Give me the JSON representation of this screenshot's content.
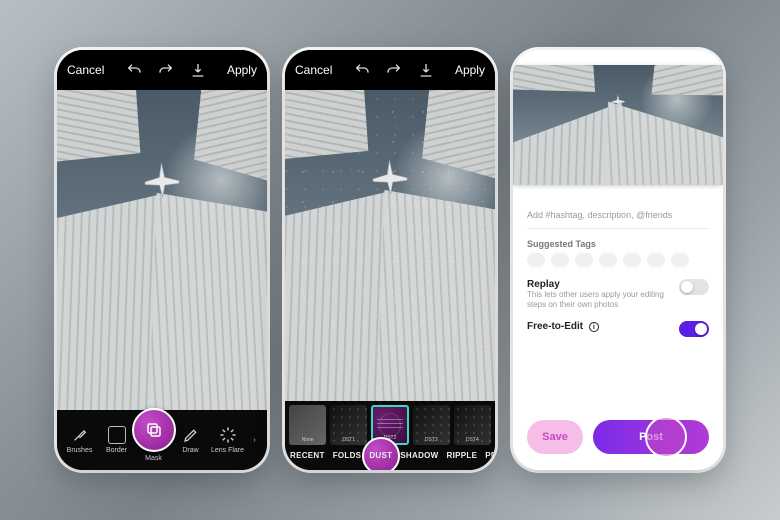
{
  "topbar": {
    "cancel": "Cancel",
    "apply": "Apply"
  },
  "tools": {
    "items": [
      {
        "name": "brushes",
        "label": "Brushes"
      },
      {
        "name": "border",
        "label": "Border"
      },
      {
        "name": "mask",
        "label": "Mask"
      },
      {
        "name": "draw",
        "label": "Draw"
      },
      {
        "name": "lensflare",
        "label": "Lens Flare"
      }
    ],
    "selected": "mask"
  },
  "filters": {
    "thumbs": [
      {
        "id": "none",
        "label": "None"
      },
      {
        "id": "dst1",
        "label": "DST1"
      },
      {
        "id": "dst2",
        "label": "DST2"
      },
      {
        "id": "dst3",
        "label": "DST3"
      },
      {
        "id": "dst4",
        "label": "DST4"
      }
    ],
    "selected_thumb": "dst2",
    "categories": [
      "RECENT",
      "FOLDS",
      "DUST",
      "SHADOW",
      "RIPPLE",
      "PRISM"
    ],
    "selected_category": "DUST"
  },
  "share": {
    "placeholder": "Add #hashtag, description, @friends",
    "suggested_label": "Suggested Tags",
    "replay": {
      "label": "Replay",
      "sub": "This lets other users apply your editing steps on their own photos",
      "on": false
    },
    "free": {
      "label": "Free-to-Edit",
      "on": true
    },
    "save": "Save",
    "post": "Post"
  }
}
